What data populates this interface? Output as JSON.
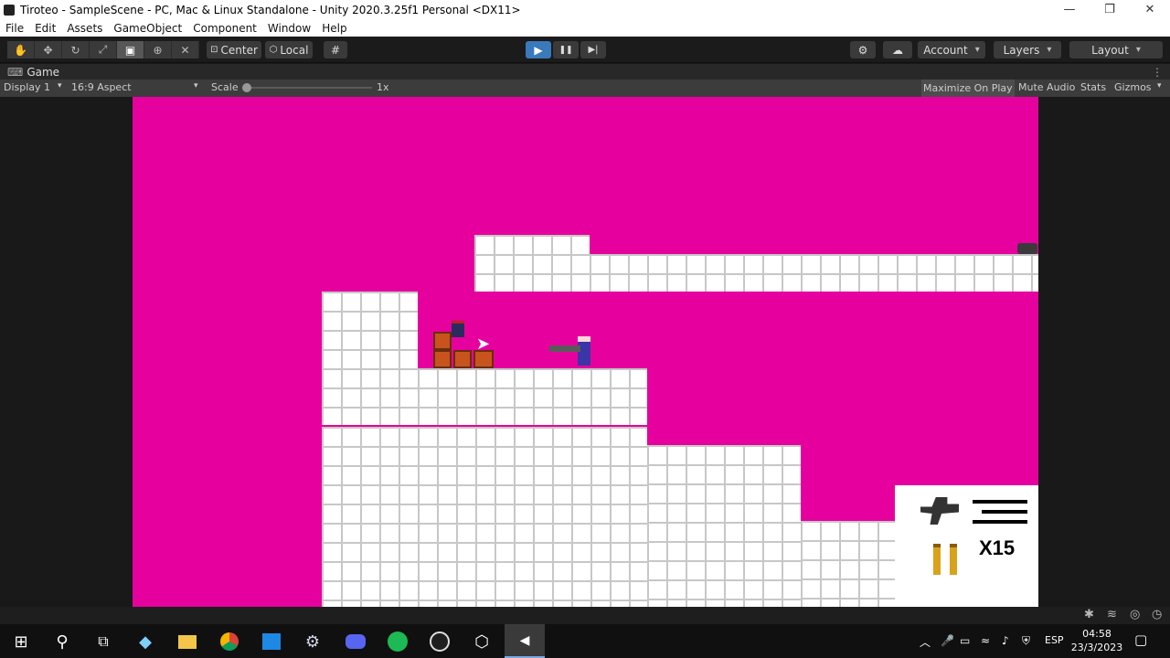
{
  "window": {
    "title": "Tiroteo - SampleScene - PC, Mac & Linux Standalone - Unity 2020.3.25f1 Personal <DX11>",
    "controls": {
      "minimize": "—",
      "restore": "❐",
      "close": "✕"
    }
  },
  "menu": [
    "File",
    "Edit",
    "Assets",
    "GameObject",
    "Component",
    "Window",
    "Help"
  ],
  "toolbar": {
    "tools": [
      "hand-tool-icon",
      "move-tool-icon",
      "rotate-tool-icon",
      "scale-tool-icon",
      "rect-tool-icon",
      "transform-tool-icon",
      "custom-tool-icon"
    ],
    "pivot_label": "Center",
    "space_label": "Local",
    "play_icon": "▶",
    "pause_icon": "❚❚",
    "step_icon": "▶|",
    "account_label": "Account",
    "layers_label": "Layers",
    "layout_label": "Layout"
  },
  "tab": {
    "label": "Game"
  },
  "gamebar": {
    "display": "Display 1",
    "aspect": "16:9 Aspect",
    "scale_label": "Scale",
    "scale_value": "1x",
    "maximize": "Maximize On Play",
    "mute": "Mute Audio",
    "stats": "Stats",
    "gizmos": "Gizmos"
  },
  "hud": {
    "ammo_count": "X15"
  },
  "taskbar": {
    "apps": [
      "windows-start-icon",
      "search-icon",
      "task-view-icon",
      "notes-icon",
      "file-explorer-icon",
      "chrome-icon",
      "store-icon",
      "steam-icon",
      "discord-icon",
      "spotify-icon",
      "obs-icon",
      "unity-hub-icon",
      "unity-editor-icon"
    ],
    "language": "ESP",
    "time": "04:58",
    "date": "23/3/2023"
  },
  "colors": {
    "game_bg": "#e6009e",
    "play_active": "#3a79bb"
  }
}
